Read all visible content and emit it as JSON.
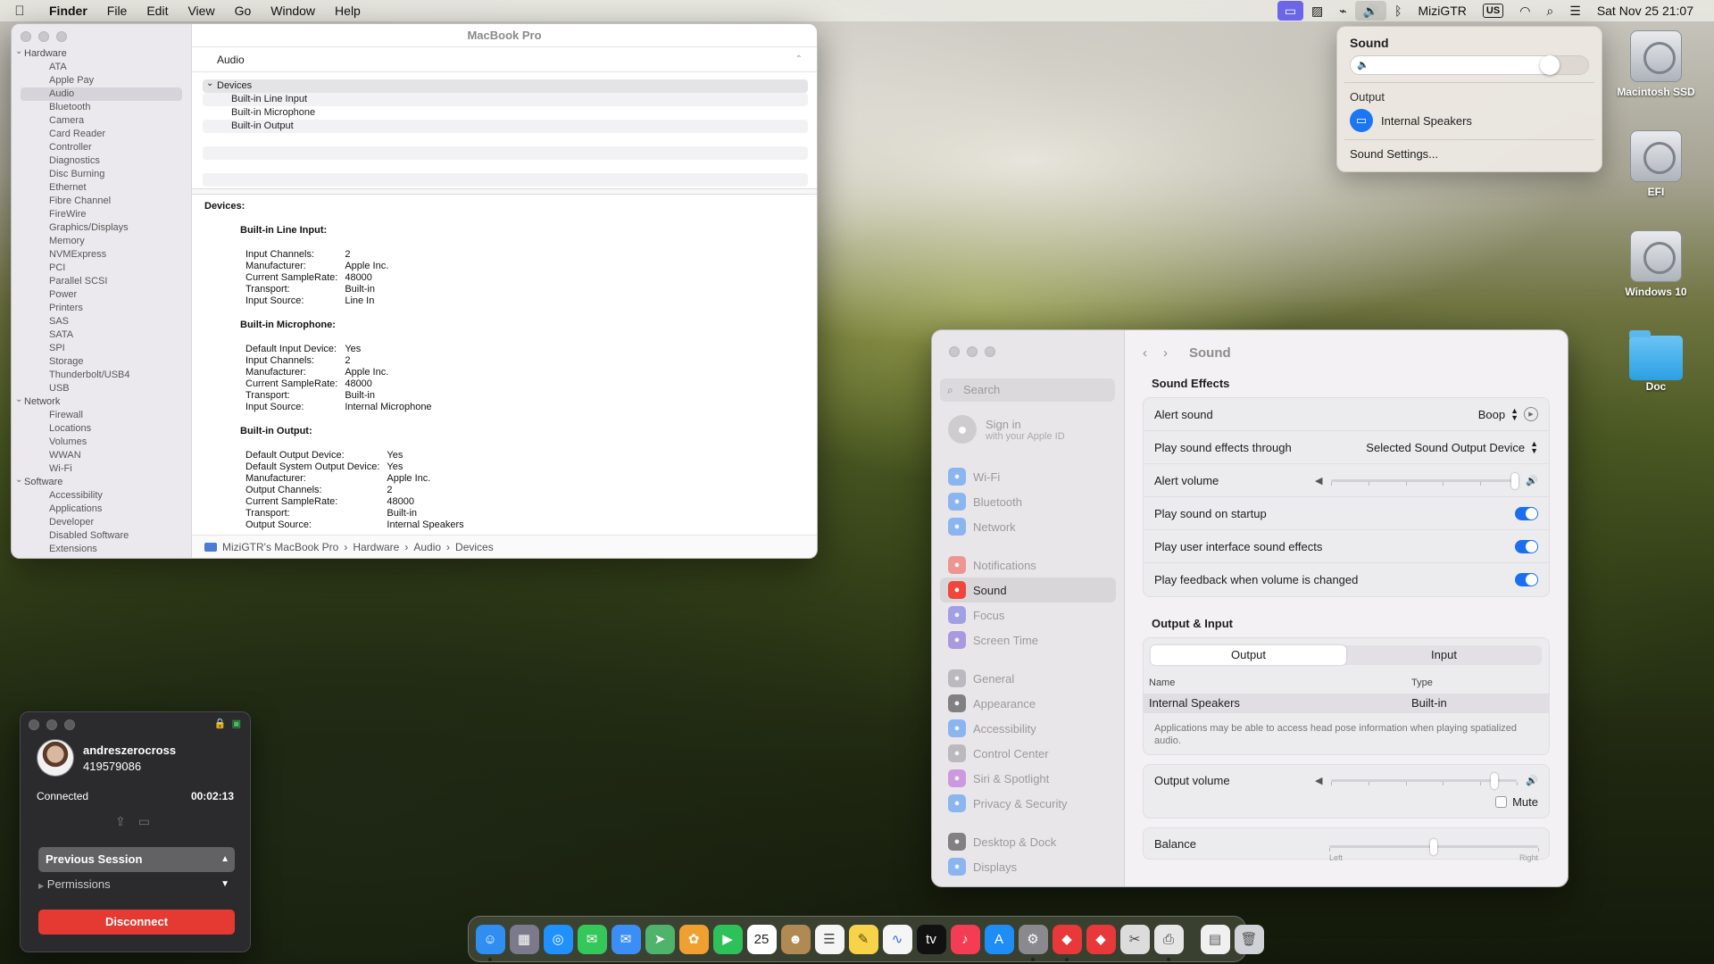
{
  "menubar": {
    "apple": "",
    "app": "Finder",
    "menus": [
      "File",
      "Edit",
      "View",
      "Go",
      "Window",
      "Help"
    ],
    "user": "MiziGTR",
    "keyboard": "US",
    "datetime": "Sat Nov 25  21:07"
  },
  "sound_menu": {
    "title": "Sound",
    "volume_percent": 88,
    "output_label": "Output",
    "output_device": "Internal Speakers",
    "settings_link": "Sound Settings..."
  },
  "desktop_icons": [
    {
      "label": "Macintosh SSD",
      "kind": "disk"
    },
    {
      "label": "EFI",
      "kind": "disk"
    },
    {
      "label": "Windows 10",
      "kind": "disk"
    },
    {
      "label": "Doc",
      "kind": "folder"
    }
  ],
  "sysinfo": {
    "title": "MacBook Pro",
    "tree": [
      {
        "type": "grp",
        "label": "Hardware"
      },
      {
        "type": "item",
        "label": "ATA"
      },
      {
        "type": "item",
        "label": "Apple Pay"
      },
      {
        "type": "item",
        "label": "Audio",
        "selected": true
      },
      {
        "type": "item",
        "label": "Bluetooth"
      },
      {
        "type": "item",
        "label": "Camera"
      },
      {
        "type": "item",
        "label": "Card Reader"
      },
      {
        "type": "item",
        "label": "Controller"
      },
      {
        "type": "item",
        "label": "Diagnostics"
      },
      {
        "type": "item",
        "label": "Disc Burning"
      },
      {
        "type": "item",
        "label": "Ethernet"
      },
      {
        "type": "item",
        "label": "Fibre Channel"
      },
      {
        "type": "item",
        "label": "FireWire"
      },
      {
        "type": "item",
        "label": "Graphics/Displays"
      },
      {
        "type": "item",
        "label": "Memory"
      },
      {
        "type": "item",
        "label": "NVMExpress"
      },
      {
        "type": "item",
        "label": "PCI"
      },
      {
        "type": "item",
        "label": "Parallel SCSI"
      },
      {
        "type": "item",
        "label": "Power"
      },
      {
        "type": "item",
        "label": "Printers"
      },
      {
        "type": "item",
        "label": "SAS"
      },
      {
        "type": "item",
        "label": "SATA"
      },
      {
        "type": "item",
        "label": "SPI"
      },
      {
        "type": "item",
        "label": "Storage"
      },
      {
        "type": "item",
        "label": "Thunderbolt/USB4"
      },
      {
        "type": "item",
        "label": "USB"
      },
      {
        "type": "grp",
        "label": "Network"
      },
      {
        "type": "item",
        "label": "Firewall"
      },
      {
        "type": "item",
        "label": "Locations"
      },
      {
        "type": "item",
        "label": "Volumes"
      },
      {
        "type": "item",
        "label": "WWAN"
      },
      {
        "type": "item",
        "label": "Wi-Fi"
      },
      {
        "type": "grp",
        "label": "Software"
      },
      {
        "type": "item",
        "label": "Accessibility"
      },
      {
        "type": "item",
        "label": "Applications"
      },
      {
        "type": "item",
        "label": "Developer"
      },
      {
        "type": "item",
        "label": "Disabled Software"
      },
      {
        "type": "item",
        "label": "Extensions"
      }
    ],
    "header": "Audio",
    "list": [
      {
        "type": "group",
        "label": "Devices"
      },
      {
        "type": "child",
        "label": "Built-in Line Input"
      },
      {
        "type": "child",
        "label": "Built-in Microphone"
      },
      {
        "type": "child",
        "label": "Built-in Output"
      }
    ],
    "detail_heading": "Devices:",
    "devices": [
      {
        "name": "Built-in Line Input:",
        "props": [
          [
            "Input Channels:",
            "2"
          ],
          [
            "Manufacturer:",
            "Apple Inc."
          ],
          [
            "Current SampleRate:",
            "48000"
          ],
          [
            "Transport:",
            "Built-in"
          ],
          [
            "Input Source:",
            "Line In"
          ]
        ]
      },
      {
        "name": "Built-in Microphone:",
        "props": [
          [
            "Default Input Device:",
            "Yes"
          ],
          [
            "Input Channels:",
            "2"
          ],
          [
            "Manufacturer:",
            "Apple Inc."
          ],
          [
            "Current SampleRate:",
            "48000"
          ],
          [
            "Transport:",
            "Built-in"
          ],
          [
            "Input Source:",
            "Internal Microphone"
          ]
        ]
      },
      {
        "name": "Built-in Output:",
        "props": [
          [
            "Default Output Device:",
            "Yes"
          ],
          [
            "Default System Output Device:",
            "Yes"
          ],
          [
            "Manufacturer:",
            "Apple Inc."
          ],
          [
            "Output Channels:",
            "2"
          ],
          [
            "Current SampleRate:",
            "48000"
          ],
          [
            "Transport:",
            "Built-in"
          ],
          [
            "Output Source:",
            "Internal Speakers"
          ]
        ]
      }
    ],
    "path": [
      "MiziGTR's MacBook Pro",
      "Hardware",
      "Audio",
      "Devices"
    ]
  },
  "settings": {
    "search_placeholder": "Search",
    "signin_title": "Sign in",
    "signin_sub": "with your Apple ID",
    "nav": [
      {
        "label": "Wi-Fi",
        "icon": "wifi-icon",
        "color": "#2f86f6"
      },
      {
        "label": "Bluetooth",
        "icon": "bluetooth-icon",
        "color": "#2f86f6"
      },
      {
        "label": "Network",
        "icon": "network-icon",
        "color": "#2f86f6"
      },
      {
        "gap": true
      },
      {
        "label": "Notifications",
        "icon": "notifications-icon",
        "color": "#f0463c"
      },
      {
        "label": "Sound",
        "icon": "sound-icon",
        "color": "#f0463c",
        "selected": true
      },
      {
        "label": "Focus",
        "icon": "focus-icon",
        "color": "#5c5ce0"
      },
      {
        "label": "Screen Time",
        "icon": "screen-time-icon",
        "color": "#6b4fd8"
      },
      {
        "gap": true
      },
      {
        "label": "General",
        "icon": "general-icon",
        "color": "#8e8e93"
      },
      {
        "label": "Appearance",
        "icon": "appearance-icon",
        "color": "#1c1c1e"
      },
      {
        "label": "Accessibility",
        "icon": "accessibility-icon",
        "color": "#2f86f6"
      },
      {
        "label": "Control Center",
        "icon": "control-center-icon",
        "color": "#8e8e93"
      },
      {
        "label": "Siri & Spotlight",
        "icon": "siri-icon",
        "color": "#b04fd8"
      },
      {
        "label": "Privacy & Security",
        "icon": "privacy-icon",
        "color": "#2f86f6"
      },
      {
        "gap": true
      },
      {
        "label": "Desktop & Dock",
        "icon": "desktop-dock-icon",
        "color": "#1c1c1e"
      },
      {
        "label": "Displays",
        "icon": "displays-icon",
        "color": "#2f86f6"
      }
    ],
    "page_title": "Sound",
    "effects_heading": "Sound Effects",
    "alert_sound_label": "Alert sound",
    "alert_sound_value": "Boop",
    "play_through_label": "Play sound effects through",
    "play_through_value": "Selected Sound Output Device",
    "alert_volume_label": "Alert volume",
    "alert_volume_level": 0.99,
    "startup_label": "Play sound on startup",
    "ui_effects_label": "Play user interface sound effects",
    "feedback_label": "Play feedback when volume is changed",
    "io_heading": "Output & Input",
    "tab_output": "Output",
    "tab_input": "Input",
    "col_name": "Name",
    "col_type": "Type",
    "device_name": "Internal Speakers",
    "device_type": "Built-in",
    "note": "Applications may be able to access head pose information when playing spatialized audio.",
    "output_volume_label": "Output volume",
    "output_volume_level": 0.88,
    "mute_label": "Mute",
    "balance_label": "Balance",
    "balance_level": 0.5,
    "balance_left": "Left",
    "balance_right": "Right"
  },
  "remote": {
    "username": "andreszerocross",
    "id": "419579086",
    "status": "Connected",
    "timer": "00:02:13",
    "session_select": "Previous Session",
    "permissions": "Permissions",
    "disconnect": "Disconnect"
  },
  "dock": {
    "items": [
      {
        "name": "finder-icon",
        "color": "#2f8ef0",
        "glyph": "☺",
        "running": true
      },
      {
        "name": "launchpad-icon",
        "color": "#7a7a8c",
        "glyph": "▦"
      },
      {
        "name": "safari-icon",
        "color": "#1e90ff",
        "glyph": "◎"
      },
      {
        "name": "messages-icon",
        "color": "#34c759",
        "glyph": "✉"
      },
      {
        "name": "mail-icon",
        "color": "#3a8ef6",
        "glyph": "✉"
      },
      {
        "name": "maps-icon",
        "color": "#4fb36b",
        "glyph": "➤"
      },
      {
        "name": "photos-icon",
        "color": "#f0a030",
        "glyph": "✿"
      },
      {
        "name": "facetime-icon",
        "color": "#2ec15a",
        "glyph": "▶"
      },
      {
        "name": "calendar-icon",
        "color": "#ffffff",
        "glyph": "25",
        "text_color": "#222"
      },
      {
        "name": "contacts-icon",
        "color": "#b08a52",
        "glyph": "☻"
      },
      {
        "name": "reminders-icon",
        "color": "#f5f5f5",
        "glyph": "☰",
        "text_color": "#444"
      },
      {
        "name": "notes-icon",
        "color": "#f7d34a",
        "glyph": "✎",
        "text_color": "#5a4a10"
      },
      {
        "name": "freeform-icon",
        "color": "#f5f5f5",
        "glyph": "∿",
        "text_color": "#2a6cf0"
      },
      {
        "name": "apple-tv-icon",
        "color": "#111111",
        "glyph": "tv"
      },
      {
        "name": "music-icon",
        "color": "#f43c54",
        "glyph": "♪"
      },
      {
        "name": "app-store-icon",
        "color": "#1e8ef6",
        "glyph": "A"
      },
      {
        "name": "system-settings-icon",
        "color": "#8a8a8e",
        "glyph": "⚙",
        "running": true
      },
      {
        "name": "anydesk-icon",
        "color": "#e8383a",
        "glyph": "◆",
        "running": true
      },
      {
        "name": "anydesk-alt-icon",
        "color": "#e8383a",
        "glyph": "◆"
      },
      {
        "name": "preview-icon",
        "color": "#dcdcdc",
        "glyph": "✂",
        "text_color": "#444"
      },
      {
        "name": "printer-icon",
        "color": "#e6e6e6",
        "glyph": "⎙",
        "text_color": "#444",
        "running": true
      }
    ],
    "trailing": [
      {
        "name": "document-icon",
        "color": "#f0f0f0",
        "glyph": "▤",
        "text_color": "#555"
      },
      {
        "name": "trash-icon",
        "color": "#cfd2d6",
        "glyph": "🗑",
        "text_color": "#555"
      }
    ]
  }
}
